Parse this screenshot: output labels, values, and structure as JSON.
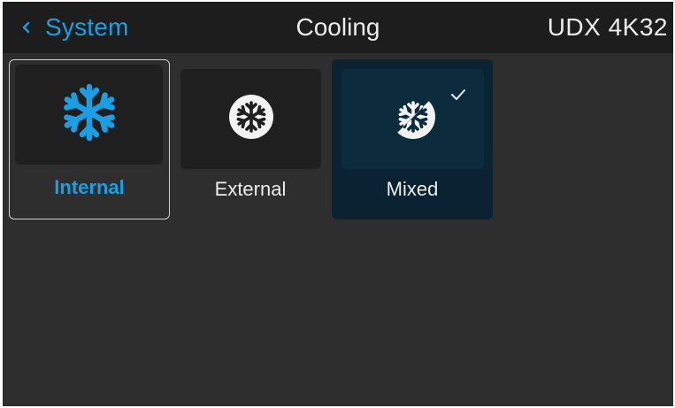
{
  "header": {
    "back_label": "System",
    "title": "Cooling",
    "device": "UDX 4K32"
  },
  "options": [
    {
      "label": "Internal",
      "icon": "snowflake-icon",
      "state": "focused"
    },
    {
      "label": "External",
      "icon": "snowflake-circle-icon",
      "state": "normal"
    },
    {
      "label": "Mixed",
      "icon": "snowflake-half-circle-icon",
      "state": "selected"
    }
  ],
  "colors": {
    "accent": "#1b9ee3",
    "background": "#2e2e2e",
    "header_background": "#1d1d1d",
    "selected_tile": "#0a2232",
    "text": "#ececec"
  }
}
